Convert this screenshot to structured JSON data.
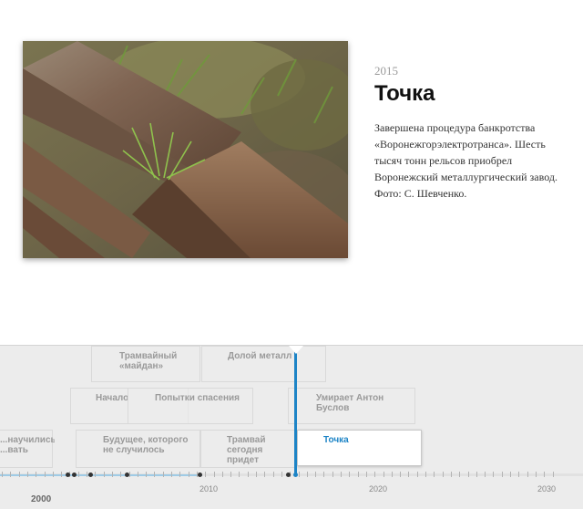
{
  "slide": {
    "year": "2015",
    "title": "Точка",
    "description": "Завершена процедура банкротства «Воронежгорэлектротранса». Шесть тысяч тонн рельсов приобрел Воронежский металлургический завод. Фото: С. Шевченко."
  },
  "timeline": {
    "events": [
      {
        "label": "Трамвайный «майдан»"
      },
      {
        "label": "Долой металл"
      },
      {
        "label": "Начало"
      },
      {
        "label": "Попытки спасения"
      },
      {
        "label": "Умирает Антон Буслов"
      },
      {
        "label": "...научились ...вать"
      },
      {
        "label": "Будущее, которого не случилось"
      },
      {
        "label": "Трамвай сегодня придет"
      },
      {
        "label": "Точка",
        "active": true
      }
    ],
    "axis": {
      "tick_labels": [
        "2010",
        "2020",
        "2030"
      ],
      "major_label": "2000"
    },
    "colors": {
      "accent": "#1d84c6",
      "background": "#ececec"
    }
  }
}
